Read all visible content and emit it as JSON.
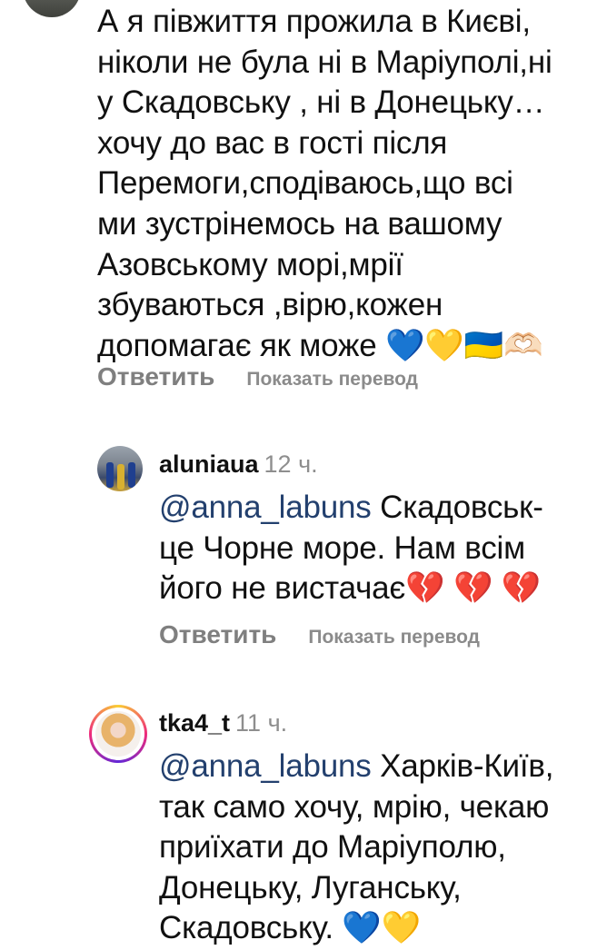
{
  "comments": [
    {
      "text": "А я півжиття прожила в Києві,\nніколи не була ні в Маріуполі,ні\nу Скадовську , ні в Донецьку…\nхочу до вас в гості після\nПеремоги,сподіваюсь,що всі\nми зустрінемось на вашому\nАзовському морі,мрії\nзбуваються ,вірю,кожен\nдопомагає як може 💙💛🇺🇦🫶🏻",
      "reply_label": "Ответить",
      "translate_label": "Показать перевод"
    }
  ],
  "replies": [
    {
      "username": "aluniaua",
      "time": "12 ч.",
      "mention": "@anna_labuns",
      "text": " Скадовськ-\nце Чорне море. Нам всім\nйого не вистачає💔 💔 💔",
      "reply_label": "Ответить",
      "translate_label": "Показать перевод"
    },
    {
      "username": "tka4_t",
      "time": "11 ч.",
      "mention": "@anna_labuns",
      "text": " Харків-Київ,\nтак само хочу, мрію, чекаю\nприїхати до Маріуполю,\nДонецьку, Луганську,\nСкадовську. 💙💛"
    }
  ]
}
